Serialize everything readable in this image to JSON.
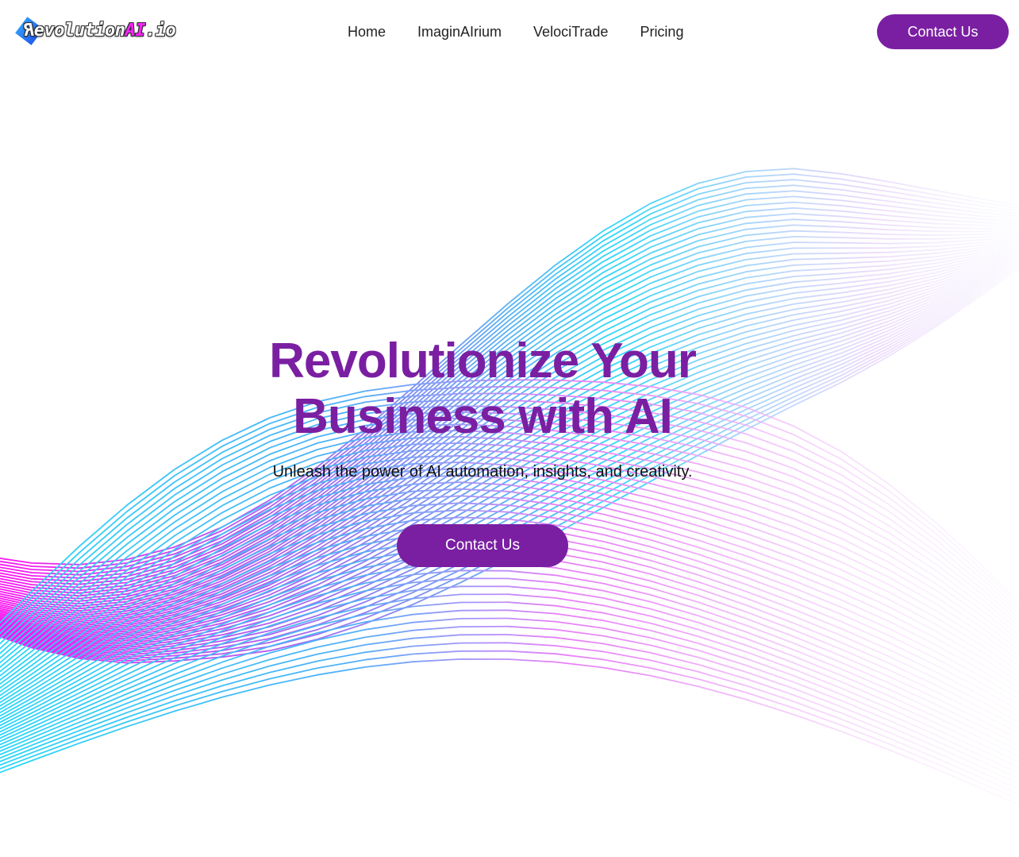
{
  "brand": {
    "logo_prefix_flipped": "R",
    "logo_main": "evolution",
    "logo_accent": "AI",
    "logo_suffix": ".io"
  },
  "nav": {
    "items": [
      {
        "label": "Home"
      },
      {
        "label": "ImaginAIrium"
      },
      {
        "label": "VelociTrade"
      },
      {
        "label": "Pricing"
      }
    ]
  },
  "header": {
    "cta_label": "Contact Us"
  },
  "hero": {
    "title_line1": "Revolutionize Your",
    "title_line2": "Business with AI",
    "subtitle": "Unleash the power of AI automation, insights, and creativity.",
    "cta_label": "Contact Us"
  },
  "colors": {
    "brand_purple": "#7a1fa2",
    "wave_magenta": "#ff22ff",
    "wave_cyan": "#22d8f8",
    "logo_accent": "#ff22ff"
  },
  "icons": {
    "logo_mark": "blue-diamond-icon",
    "background": "abstract-wave-lines"
  }
}
